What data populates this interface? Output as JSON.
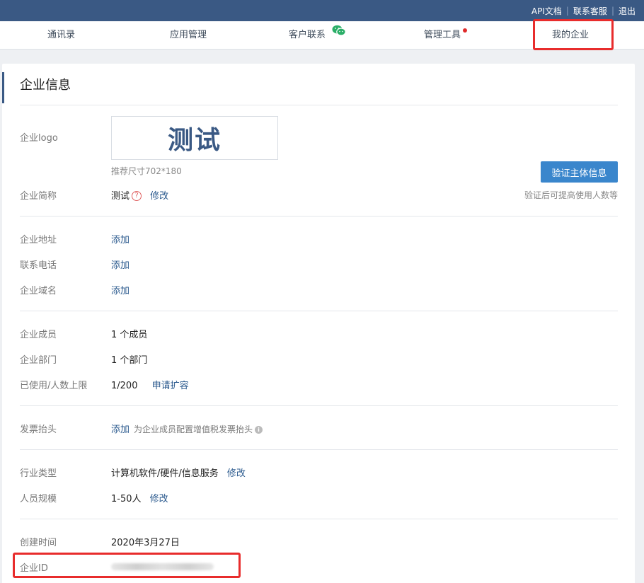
{
  "topbar": {
    "links": [
      {
        "label": "API文档"
      },
      {
        "label": "联系客服"
      },
      {
        "label": "退出"
      }
    ]
  },
  "nav": {
    "items": [
      {
        "label": "通讯录"
      },
      {
        "label": "应用管理"
      },
      {
        "label": "客户联系"
      },
      {
        "label": "管理工具"
      },
      {
        "label": "我的企业"
      }
    ],
    "active": "我的企业"
  },
  "card": {
    "title": "企业信息",
    "logo": {
      "label": "企业logo",
      "text": "测试",
      "hint": "推荐尺寸702*180"
    },
    "verify": {
      "button": "验证主体信息",
      "note": "验证后可提高使用人数等"
    },
    "short_name": {
      "label": "企业简称",
      "value": "测试",
      "help": "?",
      "action": "修改"
    },
    "address": {
      "label": "企业地址",
      "action": "添加"
    },
    "phone": {
      "label": "联系电话",
      "action": "添加"
    },
    "domain": {
      "label": "企业域名",
      "action": "添加"
    },
    "members": {
      "label": "企业成员",
      "value": "1 个成员"
    },
    "departments": {
      "label": "企业部门",
      "value": "1 个部门"
    },
    "limit": {
      "label": "已使用/人数上限",
      "value": "1/200",
      "action": "申请扩容"
    },
    "invoice": {
      "label": "发票抬头",
      "action": "添加",
      "note": "为企业成员配置增值税发票抬头",
      "info": "i"
    },
    "industry": {
      "label": "行业类型",
      "value": "计算机软件/硬件/信息服务",
      "action": "修改"
    },
    "scale": {
      "label": "人员规模",
      "value": "1-50人",
      "action": "修改"
    },
    "created": {
      "label": "创建时间",
      "value": "2020年3月27日"
    },
    "corp_id": {
      "label": "企业ID"
    }
  },
  "colors": {
    "topbar": "#3a5984",
    "accent": "#3a5984",
    "button": "#3a86cc",
    "link": "#2b5a8e",
    "highlight": "#e82c2c",
    "notify_dot": "#e02a2a"
  },
  "icons": {
    "customer_contact": "wechat-icon",
    "help": "question-circle-icon",
    "info": "info-circle-icon"
  }
}
